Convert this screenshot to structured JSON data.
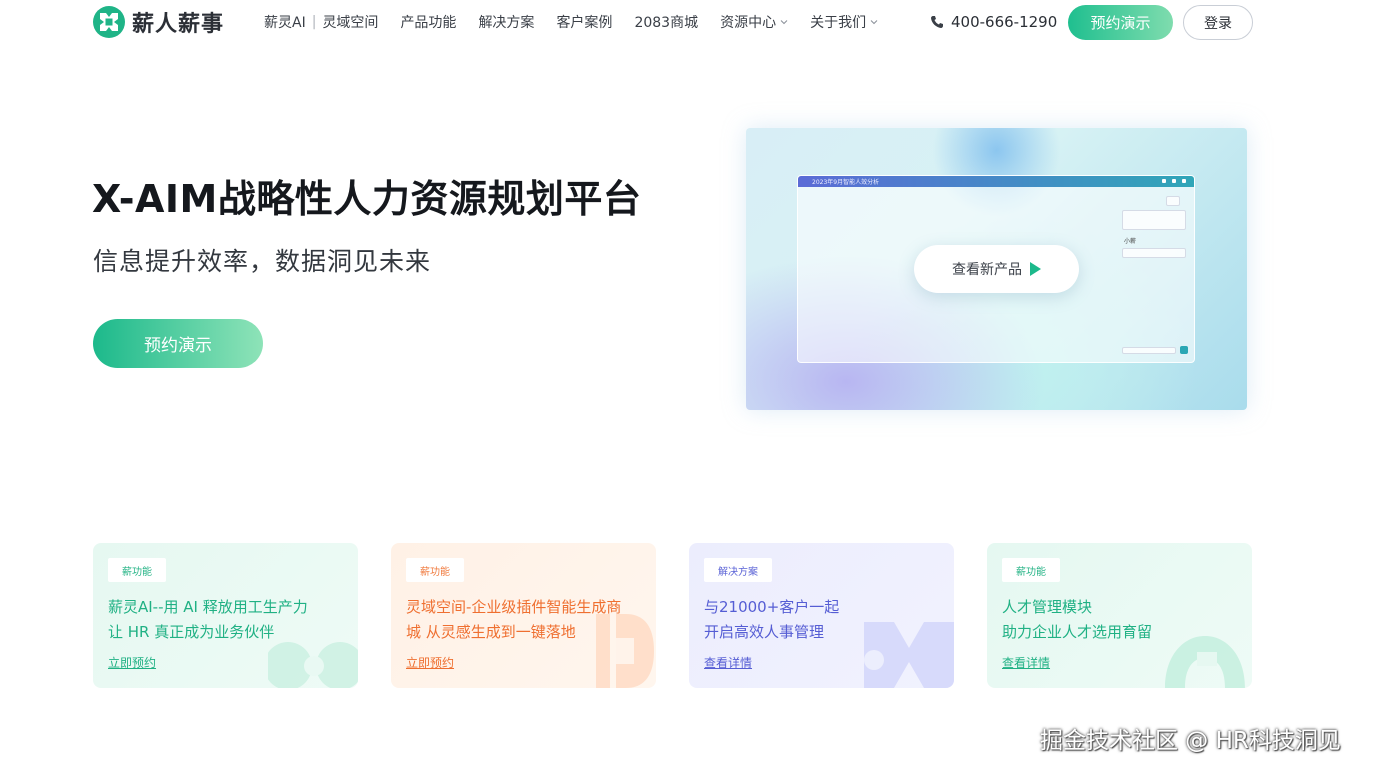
{
  "header": {
    "logo_text": "薪人薪事",
    "logo_icon": "xinrenxinshi-logo-icon",
    "nav": [
      {
        "label": "薪灵AI",
        "sep": "|",
        "label2": "灵域空间"
      },
      {
        "label": "产品功能"
      },
      {
        "label": "解决方案"
      },
      {
        "label": "客户案例"
      },
      {
        "label": "2083商城"
      },
      {
        "label": "资源中心",
        "dropdown": true
      },
      {
        "label": "关于我们",
        "dropdown": true
      }
    ],
    "phone_icon": "phone-icon",
    "phone": "400-666-1290",
    "demo_button": "预约演示",
    "login_button": "登录"
  },
  "hero": {
    "title": "X-AIM战略性人力资源规划平台",
    "subtitle": "信息提升效率，数据洞见未来",
    "demo_button": "预约演示",
    "preview": {
      "window_title": "2023年9月智能人效分析",
      "view_button": "查看新产品",
      "play_icon": "play-icon",
      "side_name": "小薪"
    }
  },
  "cards": [
    {
      "tag": "薪功能",
      "title_line1": "薪灵AI--用 AI 释放用工生产力",
      "title_line2": "让 HR 真正成为业务伙伴",
      "link": "立即预约"
    },
    {
      "tag": "薪功能",
      "title_line1": "灵域空间-企业级插件智能生成商",
      "title_line2": "城 从灵感生成到一键落地",
      "link": "立即预约"
    },
    {
      "tag": "解决方案",
      "title_line1": "与21000+客户一起",
      "title_line2": "开启高效人事管理",
      "link": "查看详情"
    },
    {
      "tag": "薪功能",
      "title_line1": "人才管理模块",
      "title_line2": "助力企业人才选用育留",
      "link": "查看详情"
    }
  ],
  "colors": {
    "brand_green": "#1cb98b",
    "orange": "#ef6f30",
    "indigo": "#555dd4"
  },
  "watermark": "掘金技术社区 @ HR科技洞见"
}
